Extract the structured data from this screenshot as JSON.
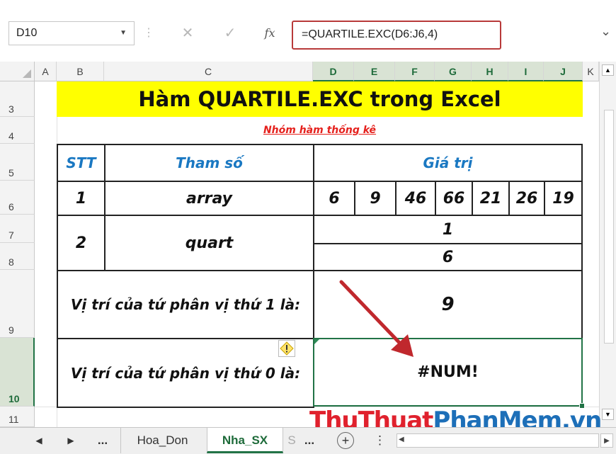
{
  "formula_bar": {
    "name_box": "D10",
    "cancel_icon": "✕",
    "enter_icon": "✓",
    "fx_label": "fx",
    "formula": "=QUARTILE.EXC(D6:J6,4)"
  },
  "columns": [
    "A",
    "B",
    "C",
    "D",
    "E",
    "F",
    "G",
    "H",
    "I",
    "J",
    "K"
  ],
  "rows": [
    "3",
    "4",
    "5",
    "6",
    "7",
    "8",
    "9",
    "10",
    "11"
  ],
  "sheet": {
    "title": "Hàm QUARTILE.EXC trong Excel",
    "subtitle": "Nhóm hàm thống kê",
    "header_stt": "STT",
    "header_param": "Tham số",
    "header_value": "Giá trị",
    "row1_stt": "1",
    "row1_param": "array",
    "array_values": [
      "6",
      "9",
      "46",
      "66",
      "21",
      "26",
      "19"
    ],
    "row2_stt": "2",
    "row2_param": "quart",
    "quart_val1": "1",
    "quart_val2": "6",
    "q1_label": "Vị trí của tứ phân vị thứ 1 là:",
    "q1_value": "9",
    "q4_label": "Vị trí của tứ phân vị thứ 0 là:",
    "q4_value": "#NUM!"
  },
  "tabs": {
    "ellipsis": "...",
    "tab1": "Hoa_Don",
    "tab2": "Nha_SX",
    "tab3": "S",
    "more": "...",
    "add": "+"
  },
  "watermark": {
    "part1": "ThuThuat",
    "part2": "PhanMem.vn"
  },
  "colors": {
    "title_bg": "#ffff00",
    "accent": "#217346",
    "header_text": "#1a78c2",
    "subtitle": "#e5211d",
    "formula_highlight": "#b83a3a",
    "arrow": "#c0282d"
  }
}
